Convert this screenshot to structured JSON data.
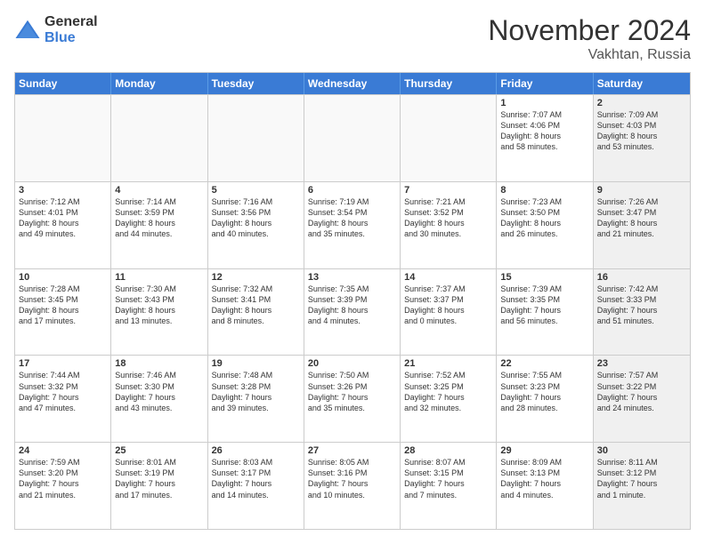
{
  "logo": {
    "general": "General",
    "blue": "Blue"
  },
  "title": "November 2024",
  "location": "Vakhtan, Russia",
  "days_header": [
    "Sunday",
    "Monday",
    "Tuesday",
    "Wednesday",
    "Thursday",
    "Friday",
    "Saturday"
  ],
  "rows": [
    [
      {
        "day": "",
        "info": "",
        "empty": true
      },
      {
        "day": "",
        "info": "",
        "empty": true
      },
      {
        "day": "",
        "info": "",
        "empty": true
      },
      {
        "day": "",
        "info": "",
        "empty": true
      },
      {
        "day": "",
        "info": "",
        "empty": true
      },
      {
        "day": "1",
        "info": "Sunrise: 7:07 AM\nSunset: 4:06 PM\nDaylight: 8 hours\nand 58 minutes.",
        "empty": false
      },
      {
        "day": "2",
        "info": "Sunrise: 7:09 AM\nSunset: 4:03 PM\nDaylight: 8 hours\nand 53 minutes.",
        "empty": false,
        "shaded": true
      }
    ],
    [
      {
        "day": "3",
        "info": "Sunrise: 7:12 AM\nSunset: 4:01 PM\nDaylight: 8 hours\nand 49 minutes.",
        "empty": false
      },
      {
        "day": "4",
        "info": "Sunrise: 7:14 AM\nSunset: 3:59 PM\nDaylight: 8 hours\nand 44 minutes.",
        "empty": false
      },
      {
        "day": "5",
        "info": "Sunrise: 7:16 AM\nSunset: 3:56 PM\nDaylight: 8 hours\nand 40 minutes.",
        "empty": false
      },
      {
        "day": "6",
        "info": "Sunrise: 7:19 AM\nSunset: 3:54 PM\nDaylight: 8 hours\nand 35 minutes.",
        "empty": false
      },
      {
        "day": "7",
        "info": "Sunrise: 7:21 AM\nSunset: 3:52 PM\nDaylight: 8 hours\nand 30 minutes.",
        "empty": false
      },
      {
        "day": "8",
        "info": "Sunrise: 7:23 AM\nSunset: 3:50 PM\nDaylight: 8 hours\nand 26 minutes.",
        "empty": false
      },
      {
        "day": "9",
        "info": "Sunrise: 7:26 AM\nSunset: 3:47 PM\nDaylight: 8 hours\nand 21 minutes.",
        "empty": false,
        "shaded": true
      }
    ],
    [
      {
        "day": "10",
        "info": "Sunrise: 7:28 AM\nSunset: 3:45 PM\nDaylight: 8 hours\nand 17 minutes.",
        "empty": false
      },
      {
        "day": "11",
        "info": "Sunrise: 7:30 AM\nSunset: 3:43 PM\nDaylight: 8 hours\nand 13 minutes.",
        "empty": false
      },
      {
        "day": "12",
        "info": "Sunrise: 7:32 AM\nSunset: 3:41 PM\nDaylight: 8 hours\nand 8 minutes.",
        "empty": false
      },
      {
        "day": "13",
        "info": "Sunrise: 7:35 AM\nSunset: 3:39 PM\nDaylight: 8 hours\nand 4 minutes.",
        "empty": false
      },
      {
        "day": "14",
        "info": "Sunrise: 7:37 AM\nSunset: 3:37 PM\nDaylight: 8 hours\nand 0 minutes.",
        "empty": false
      },
      {
        "day": "15",
        "info": "Sunrise: 7:39 AM\nSunset: 3:35 PM\nDaylight: 7 hours\nand 56 minutes.",
        "empty": false
      },
      {
        "day": "16",
        "info": "Sunrise: 7:42 AM\nSunset: 3:33 PM\nDaylight: 7 hours\nand 51 minutes.",
        "empty": false,
        "shaded": true
      }
    ],
    [
      {
        "day": "17",
        "info": "Sunrise: 7:44 AM\nSunset: 3:32 PM\nDaylight: 7 hours\nand 47 minutes.",
        "empty": false
      },
      {
        "day": "18",
        "info": "Sunrise: 7:46 AM\nSunset: 3:30 PM\nDaylight: 7 hours\nand 43 minutes.",
        "empty": false
      },
      {
        "day": "19",
        "info": "Sunrise: 7:48 AM\nSunset: 3:28 PM\nDaylight: 7 hours\nand 39 minutes.",
        "empty": false
      },
      {
        "day": "20",
        "info": "Sunrise: 7:50 AM\nSunset: 3:26 PM\nDaylight: 7 hours\nand 35 minutes.",
        "empty": false
      },
      {
        "day": "21",
        "info": "Sunrise: 7:52 AM\nSunset: 3:25 PM\nDaylight: 7 hours\nand 32 minutes.",
        "empty": false
      },
      {
        "day": "22",
        "info": "Sunrise: 7:55 AM\nSunset: 3:23 PM\nDaylight: 7 hours\nand 28 minutes.",
        "empty": false
      },
      {
        "day": "23",
        "info": "Sunrise: 7:57 AM\nSunset: 3:22 PM\nDaylight: 7 hours\nand 24 minutes.",
        "empty": false,
        "shaded": true
      }
    ],
    [
      {
        "day": "24",
        "info": "Sunrise: 7:59 AM\nSunset: 3:20 PM\nDaylight: 7 hours\nand 21 minutes.",
        "empty": false
      },
      {
        "day": "25",
        "info": "Sunrise: 8:01 AM\nSunset: 3:19 PM\nDaylight: 7 hours\nand 17 minutes.",
        "empty": false
      },
      {
        "day": "26",
        "info": "Sunrise: 8:03 AM\nSunset: 3:17 PM\nDaylight: 7 hours\nand 14 minutes.",
        "empty": false
      },
      {
        "day": "27",
        "info": "Sunrise: 8:05 AM\nSunset: 3:16 PM\nDaylight: 7 hours\nand 10 minutes.",
        "empty": false
      },
      {
        "day": "28",
        "info": "Sunrise: 8:07 AM\nSunset: 3:15 PM\nDaylight: 7 hours\nand 7 minutes.",
        "empty": false
      },
      {
        "day": "29",
        "info": "Sunrise: 8:09 AM\nSunset: 3:13 PM\nDaylight: 7 hours\nand 4 minutes.",
        "empty": false
      },
      {
        "day": "30",
        "info": "Sunrise: 8:11 AM\nSunset: 3:12 PM\nDaylight: 7 hours\nand 1 minute.",
        "empty": false,
        "shaded": true
      }
    ]
  ]
}
